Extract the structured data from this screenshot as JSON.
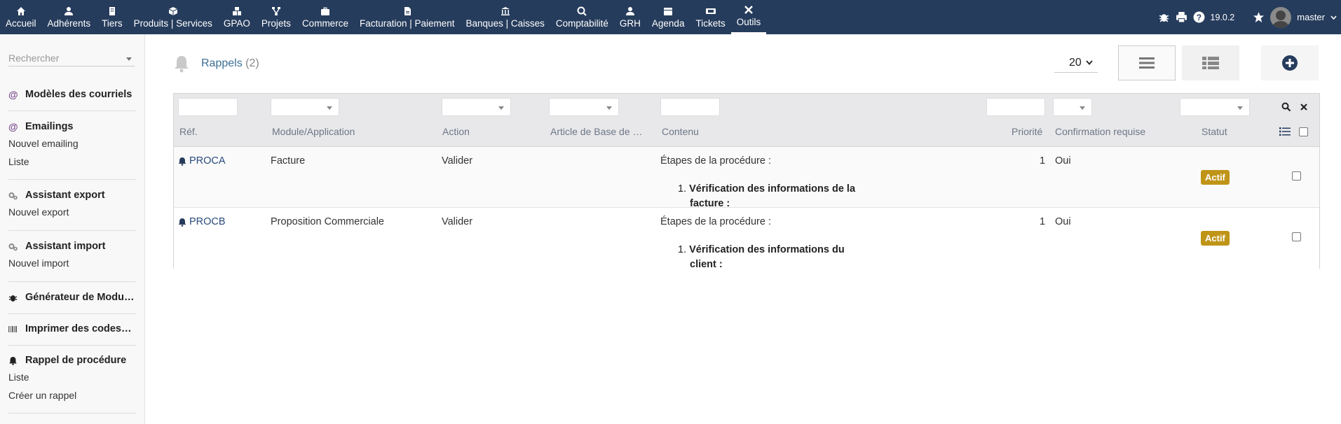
{
  "topbar": {
    "menu": [
      {
        "label": "Accueil",
        "icon": "home-icon"
      },
      {
        "label": "Adhérents",
        "icon": "user-icon"
      },
      {
        "label": "Tiers",
        "icon": "building-icon"
      },
      {
        "label": "Produits | Services",
        "icon": "cube-icon"
      },
      {
        "label": "GPAO",
        "icon": "cubes-icon"
      },
      {
        "label": "Projets",
        "icon": "sitemap-icon"
      },
      {
        "label": "Commerce",
        "icon": "suitcase-icon"
      },
      {
        "label": "Facturation | Paiement",
        "icon": "file-invoice-icon"
      },
      {
        "label": "Banques | Caisses",
        "icon": "bank-icon"
      },
      {
        "label": "Comptabilité",
        "icon": "search-dollar-icon"
      },
      {
        "label": "GRH",
        "icon": "user-tie-icon"
      },
      {
        "label": "Agenda",
        "icon": "calendar-icon"
      },
      {
        "label": "Tickets",
        "icon": "ticket-icon"
      },
      {
        "label": "Outils",
        "icon": "tools-icon"
      }
    ],
    "version": "19.0.2",
    "username": "master"
  },
  "sidebar": {
    "search_placeholder": "Rechercher",
    "sections": [
      {
        "title": "Modèles des courriels",
        "icon": "at-icon",
        "items": []
      },
      {
        "title": "Emailings",
        "icon": "at-icon",
        "items": [
          "Nouvel emailing",
          "Liste"
        ]
      },
      {
        "title": "Assistant export",
        "icon": "cogs-icon",
        "items": [
          "Nouvel export"
        ]
      },
      {
        "title": "Assistant import",
        "icon": "cogs-icon",
        "items": [
          "Nouvel import"
        ]
      },
      {
        "title": "Générateur de Modu…",
        "icon": "bug-icon",
        "items": []
      },
      {
        "title": "Imprimer des codes…",
        "icon": "barcode-icon",
        "items": []
      },
      {
        "title": "Rappel de procédure",
        "icon": "bell-icon",
        "items": [
          "Liste",
          "Créer un rappel"
        ]
      }
    ]
  },
  "main": {
    "title": "Rappels",
    "count": "(2)",
    "page_size": "20"
  },
  "table": {
    "columns": [
      "Réf.",
      "Module/Application",
      "Action",
      "Article de Base de …",
      "Contenu",
      "Priorité",
      "Confirmation requise",
      "Statut"
    ],
    "rows": [
      {
        "ref": "PROCA",
        "module": "Facture",
        "action": "Valider",
        "article": "",
        "content_intro": "Étapes de la procédure :",
        "content_item": "Vérification des informations de la",
        "content_more": "facture :",
        "priority": "1",
        "confirmation": "Oui",
        "status": "Actif"
      },
      {
        "ref": "PROCB",
        "module": "Proposition Commerciale",
        "action": "Valider",
        "article": "",
        "content_intro": "Étapes de la procédure :",
        "content_item": "Vérification des informations du",
        "content_more": "client :",
        "priority": "1",
        "confirmation": "Oui",
        "status": "Actif"
      }
    ]
  },
  "colors": {
    "topbar": "#263c5c",
    "badge": "#bf9417",
    "link": "#3b6f94"
  }
}
